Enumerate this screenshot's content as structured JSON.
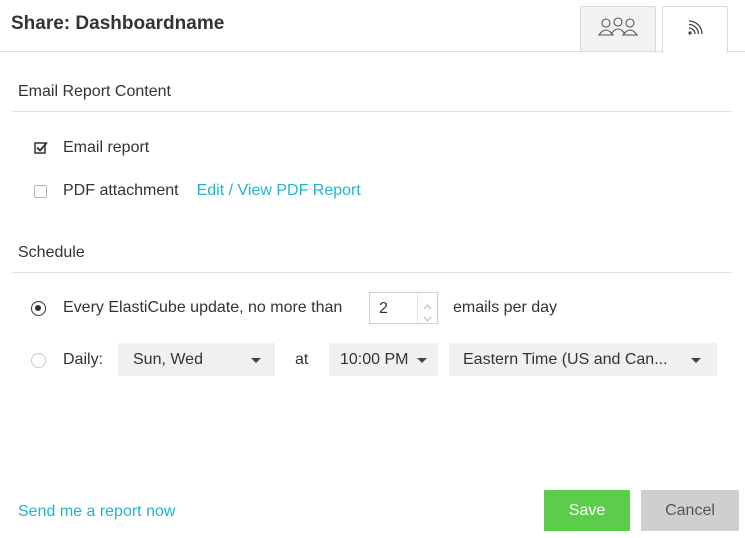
{
  "header": {
    "title": "Share: Dashboardname",
    "tabs": [
      {
        "icon": "users-icon",
        "active": false
      },
      {
        "icon": "rss-icon",
        "active": true
      }
    ]
  },
  "email_section": {
    "title": "Email Report Content",
    "email_report": {
      "label": "Email report",
      "checked": true
    },
    "pdf_attachment": {
      "label": "PDF attachment",
      "checked": false
    },
    "pdf_link": "Edit / View PDF Report"
  },
  "schedule_section": {
    "title": "Schedule",
    "option_update": {
      "label": "Every ElastiCube update, no more than",
      "selected": true,
      "count": "2",
      "suffix": "emails per day"
    },
    "option_daily": {
      "label": "Daily:",
      "selected": false,
      "days": "Sun, Wed",
      "at_label": "at",
      "time": "10:00 PM",
      "timezone": "Eastern Time (US and Can..."
    }
  },
  "footer": {
    "send_now": "Send me a report now",
    "save": "Save",
    "cancel": "Cancel"
  },
  "colors": {
    "accent_link": "#1fb6cc",
    "save_button": "#5ccc4b",
    "cancel_button": "#cfcfcf"
  }
}
